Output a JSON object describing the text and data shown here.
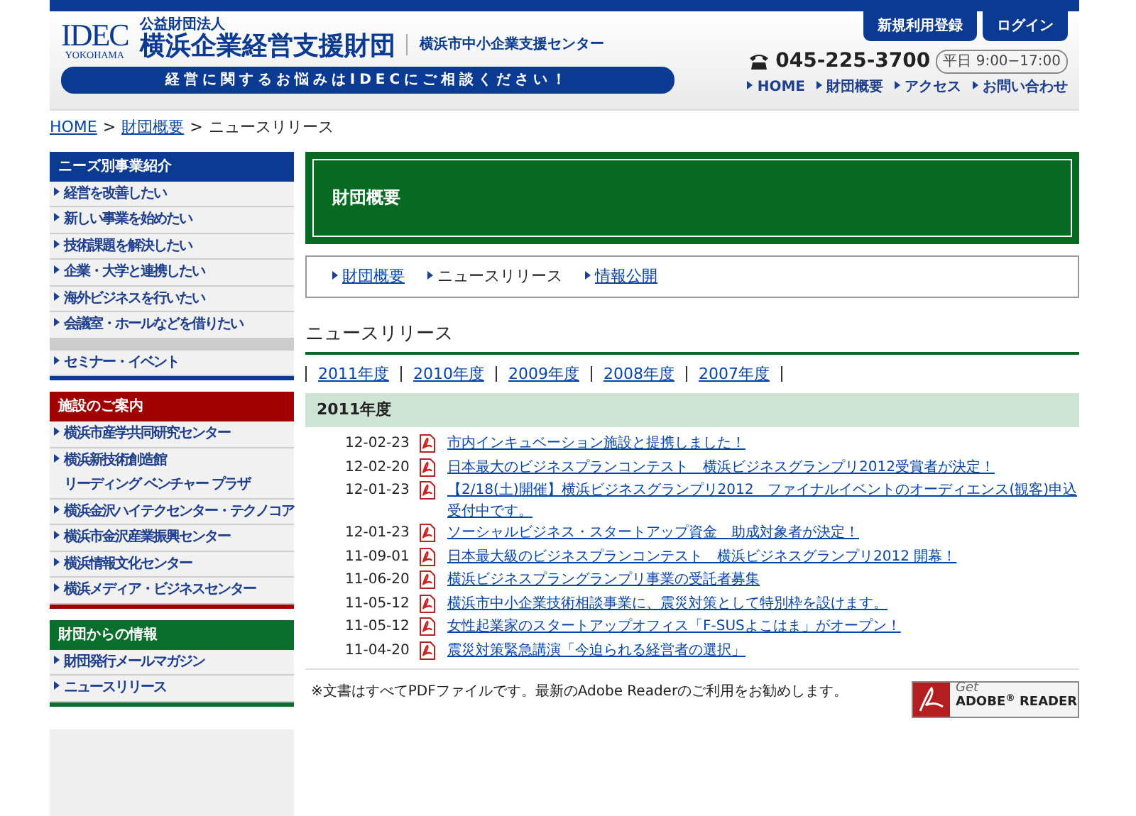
{
  "header": {
    "logo_main": "IDEC",
    "logo_sub": "YOKOHAMA",
    "org_type": "公益財団法人",
    "org_name": "横浜企業経営支援財団",
    "center_name": "横浜市中小企業支援センター",
    "slogan": "経営に関するお悩みはIDECにご相談ください！",
    "buttons": [
      "新規利用登録",
      "ログイン"
    ],
    "phone": "045-225-3700",
    "hours": "平日 9:00−17:00",
    "links": [
      "HOME",
      "財団概要",
      "アクセス",
      "お問い合わせ"
    ]
  },
  "breadcrumb": [
    {
      "label": "HOME",
      "link": true
    },
    {
      "separator": ">",
      "label": "財団概要",
      "link": true
    },
    {
      "separator": ">",
      "label": "ニュースリリース",
      "link": false
    }
  ],
  "sidebar": [
    {
      "title": "ニーズ別事業紹介",
      "color": "#0b3a92",
      "items": [
        {
          "label": "経営を改善したい",
          "kind": "item"
        },
        {
          "label": "新しい事業を始めたい",
          "kind": "item"
        },
        {
          "label": "技術課題を解決したい",
          "kind": "item"
        },
        {
          "label": "企業・大学と連携したい",
          "kind": "item"
        },
        {
          "label": "海外ビジネスを行いたい",
          "kind": "item"
        },
        {
          "label": "会議室・ホールなどを借りたい",
          "kind": "item"
        },
        {
          "label": "セミナー・イベント",
          "kind": "spaced"
        }
      ]
    },
    {
      "title": "施設のご案内",
      "color": "#a00000",
      "items": [
        {
          "label": "横浜市産学共同研究センター",
          "kind": "item"
        },
        {
          "lines": [
            "横浜新技術創造館",
            "リーディング ベンチャー プラザ"
          ],
          "kind": "item"
        },
        {
          "label": "横浜金沢ハイテクセンター・テクノコア",
          "kind": "item"
        },
        {
          "label": "横浜市金沢産業振興センター",
          "kind": "item"
        },
        {
          "label": "横浜情報文化センター",
          "kind": "item"
        },
        {
          "label": "横浜メディア・ビジネスセンター",
          "kind": "item"
        }
      ]
    },
    {
      "title": "財団からの情報",
      "color": "#0a6e2c",
      "items": [
        {
          "label": "財団発行メールマガジン",
          "kind": "item"
        },
        {
          "label": "ニュースリリース",
          "kind": "item"
        }
      ]
    }
  ],
  "page_title": "財団概要",
  "subnav": [
    {
      "label": "財団概要",
      "selected": false
    },
    {
      "label": "ニュースリリース",
      "selected": true
    },
    {
      "label": "情報公開",
      "selected": false
    }
  ],
  "section_title": "ニュースリリース",
  "years": [
    "2011年度",
    "2010年度",
    "2009年度",
    "2008年度",
    "2007年度"
  ],
  "year_heading": "2011年度",
  "news": [
    {
      "date": "12-02-23",
      "title": "市内インキュベーション施設と提携しました！"
    },
    {
      "date": "12-02-20",
      "title": "日本最大のビジネスプランコンテスト　横浜ビジネスグランプリ2012受賞者が決定！"
    },
    {
      "date": "12-01-23",
      "title": "【2/18(土)開催】横浜ビジネスグランプリ2012　ファイナルイベントのオーディエンス(観客)申込受付中です。"
    },
    {
      "date": "12-01-23",
      "title": "ソーシャルビジネス・スタートアップ資金　助成対象者が決定！"
    },
    {
      "date": "11-09-01",
      "title": "日本最大級のビジネスプランコンテスト　横浜ビジネスグランプリ2012 開幕！"
    },
    {
      "date": "11-06-20",
      "title": "横浜ビジネスプラングランプリ事業の受託者募集"
    },
    {
      "date": "11-05-12",
      "title": "横浜市中小企業技術相談事業に、震災対策として特別枠を設けます。"
    },
    {
      "date": "11-05-12",
      "title": "女性起業家のスタートアップオフィス「F-SUSよこはま」がオープン！"
    },
    {
      "date": "11-04-20",
      "title": "震災対策緊急講演「今迫られる経営者の選択」"
    }
  ],
  "note": "※文書はすべてPDFファイルです。最新のAdobe Readerのご利用をお勧めします。",
  "adobe_badge": {
    "top": "Get",
    "bottom": "ADOBE$^{®}$ READER"
  }
}
